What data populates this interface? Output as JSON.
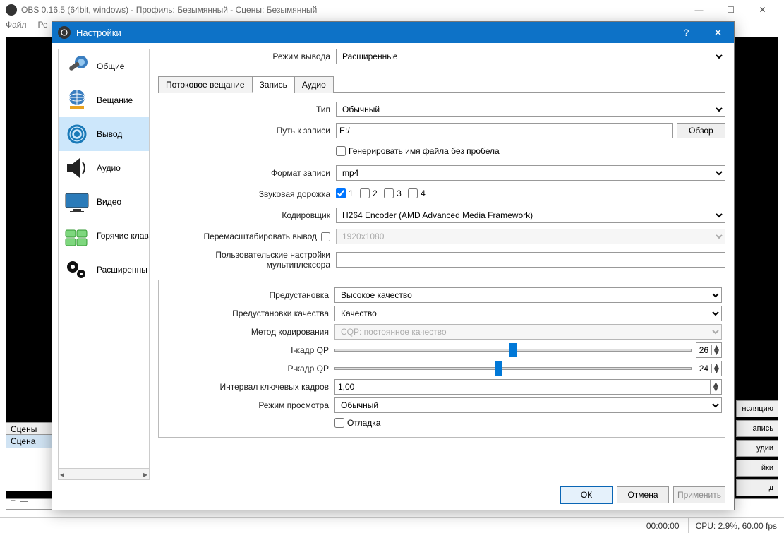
{
  "main": {
    "title": "OBS 0.16.5 (64bit, windows) - Профиль: Безымянный - Сцены: Безымянный",
    "menu": {
      "file": "Файл",
      "edit": "Ре"
    },
    "panels": {
      "scenes_title": "Сцены",
      "scene_row": "Сцена",
      "plus": "+",
      "minus": "—"
    },
    "right_buttons": {
      "b1": "нсляцию",
      "b2": "апись",
      "b3": "удии",
      "b4": "йки",
      "b5": "д"
    },
    "status": {
      "time": "00:00:00",
      "cpu": "CPU: 2.9%, 60.00 fps"
    }
  },
  "dialog": {
    "title": "Настройки",
    "sidebar": [
      {
        "label": "Общие"
      },
      {
        "label": "Вещание"
      },
      {
        "label": "Вывод",
        "selected": true
      },
      {
        "label": "Аудио"
      },
      {
        "label": "Видео"
      },
      {
        "label": "Горячие клав"
      },
      {
        "label": "Расширенны"
      }
    ],
    "output_mode_label": "Режим вывода",
    "output_mode_value": "Расширенные",
    "tabs": {
      "streaming": "Потоковое вещание",
      "recording": "Запись",
      "audio": "Аудио"
    },
    "fields": {
      "type_label": "Тип",
      "type_value": "Обычный",
      "path_label": "Путь к записи",
      "path_value": "E:/",
      "browse": "Обзор",
      "no_space_label": "Генерировать имя файла без пробела",
      "format_label": "Формат записи",
      "format_value": "mp4",
      "tracks_label": "Звуковая дорожка",
      "t1": "1",
      "t2": "2",
      "t3": "3",
      "t4": "4",
      "encoder_label": "Кодировщик",
      "encoder_value": "H264 Encoder (AMD Advanced Media Framework)",
      "rescale_label": "Перемасштабировать вывод",
      "rescale_value": "1920x1080",
      "muxer_label": "Пользовательские настройки мультиплексора",
      "preset_label": "Предустановка",
      "preset_value": "Высокое качество",
      "quality_preset_label": "Предустановки качества",
      "quality_preset_value": "Качество",
      "coding_label": "Метод кодирования",
      "coding_value": "CQP: постоянное качество",
      "iqp_label": "I-кадр QP",
      "iqp_value": "26",
      "pqp_label": "P-кадр QP",
      "pqp_value": "24",
      "keyint_label": "Интервал ключевых кадров",
      "keyint_value": "1,00",
      "viewmode_label": "Режим просмотра",
      "viewmode_value": "Обычный",
      "debug_label": "Отладка"
    },
    "buttons": {
      "ok": "ОК",
      "cancel": "Отмена",
      "apply": "Применить"
    }
  }
}
